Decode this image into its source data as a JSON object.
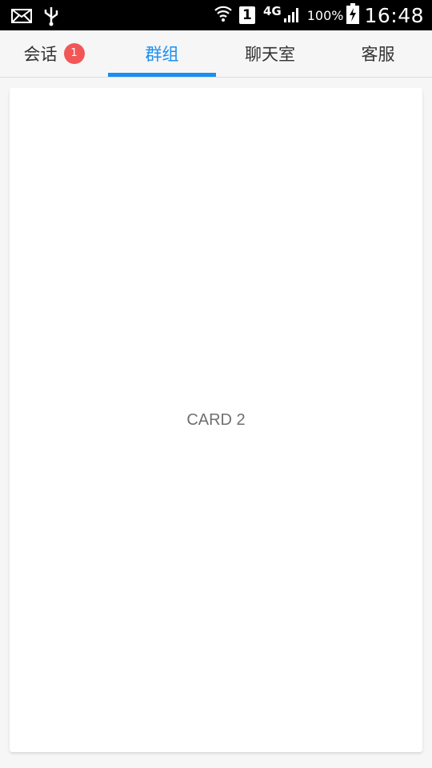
{
  "status_bar": {
    "icons": [
      "mail-icon",
      "usb-icon",
      "wifi-icon",
      "signal-icon",
      "battery-charging-icon"
    ],
    "sim": "1",
    "network": "4G",
    "battery": "100%",
    "time": "16:48"
  },
  "tabs": [
    {
      "label": "会话",
      "badge": "1"
    },
    {
      "label": "群组",
      "active": true
    },
    {
      "label": "聊天室"
    },
    {
      "label": "客服"
    }
  ],
  "accent_color": "#1a8ef1",
  "badge_color": "#f25757",
  "card": {
    "label": "CARD 2"
  }
}
